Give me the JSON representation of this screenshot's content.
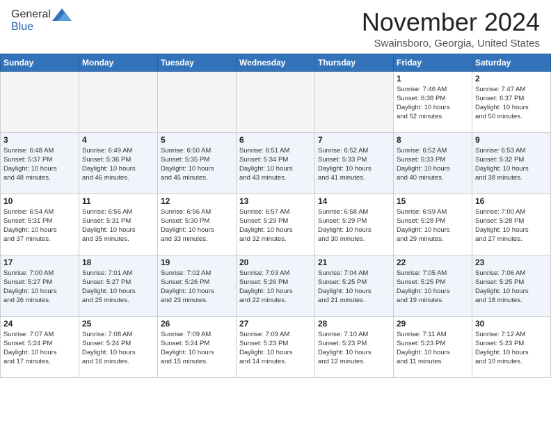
{
  "header": {
    "logo_general": "General",
    "logo_blue": "Blue",
    "month": "November 2024",
    "location": "Swainsboro, Georgia, United States"
  },
  "weekdays": [
    "Sunday",
    "Monday",
    "Tuesday",
    "Wednesday",
    "Thursday",
    "Friday",
    "Saturday"
  ],
  "weeks": [
    [
      {
        "day": "",
        "info": ""
      },
      {
        "day": "",
        "info": ""
      },
      {
        "day": "",
        "info": ""
      },
      {
        "day": "",
        "info": ""
      },
      {
        "day": "",
        "info": ""
      },
      {
        "day": "1",
        "info": "Sunrise: 7:46 AM\nSunset: 6:38 PM\nDaylight: 10 hours\nand 52 minutes."
      },
      {
        "day": "2",
        "info": "Sunrise: 7:47 AM\nSunset: 6:37 PM\nDaylight: 10 hours\nand 50 minutes."
      }
    ],
    [
      {
        "day": "3",
        "info": "Sunrise: 6:48 AM\nSunset: 5:37 PM\nDaylight: 10 hours\nand 48 minutes."
      },
      {
        "day": "4",
        "info": "Sunrise: 6:49 AM\nSunset: 5:36 PM\nDaylight: 10 hours\nand 46 minutes."
      },
      {
        "day": "5",
        "info": "Sunrise: 6:50 AM\nSunset: 5:35 PM\nDaylight: 10 hours\nand 45 minutes."
      },
      {
        "day": "6",
        "info": "Sunrise: 6:51 AM\nSunset: 5:34 PM\nDaylight: 10 hours\nand 43 minutes."
      },
      {
        "day": "7",
        "info": "Sunrise: 6:52 AM\nSunset: 5:33 PM\nDaylight: 10 hours\nand 41 minutes."
      },
      {
        "day": "8",
        "info": "Sunrise: 6:52 AM\nSunset: 5:33 PM\nDaylight: 10 hours\nand 40 minutes."
      },
      {
        "day": "9",
        "info": "Sunrise: 6:53 AM\nSunset: 5:32 PM\nDaylight: 10 hours\nand 38 minutes."
      }
    ],
    [
      {
        "day": "10",
        "info": "Sunrise: 6:54 AM\nSunset: 5:31 PM\nDaylight: 10 hours\nand 37 minutes."
      },
      {
        "day": "11",
        "info": "Sunrise: 6:55 AM\nSunset: 5:31 PM\nDaylight: 10 hours\nand 35 minutes."
      },
      {
        "day": "12",
        "info": "Sunrise: 6:56 AM\nSunset: 5:30 PM\nDaylight: 10 hours\nand 33 minutes."
      },
      {
        "day": "13",
        "info": "Sunrise: 6:57 AM\nSunset: 5:29 PM\nDaylight: 10 hours\nand 32 minutes."
      },
      {
        "day": "14",
        "info": "Sunrise: 6:58 AM\nSunset: 5:29 PM\nDaylight: 10 hours\nand 30 minutes."
      },
      {
        "day": "15",
        "info": "Sunrise: 6:59 AM\nSunset: 5:28 PM\nDaylight: 10 hours\nand 29 minutes."
      },
      {
        "day": "16",
        "info": "Sunrise: 7:00 AM\nSunset: 5:28 PM\nDaylight: 10 hours\nand 27 minutes."
      }
    ],
    [
      {
        "day": "17",
        "info": "Sunrise: 7:00 AM\nSunset: 5:27 PM\nDaylight: 10 hours\nand 26 minutes."
      },
      {
        "day": "18",
        "info": "Sunrise: 7:01 AM\nSunset: 5:27 PM\nDaylight: 10 hours\nand 25 minutes."
      },
      {
        "day": "19",
        "info": "Sunrise: 7:02 AM\nSunset: 5:26 PM\nDaylight: 10 hours\nand 23 minutes."
      },
      {
        "day": "20",
        "info": "Sunrise: 7:03 AM\nSunset: 5:26 PM\nDaylight: 10 hours\nand 22 minutes."
      },
      {
        "day": "21",
        "info": "Sunrise: 7:04 AM\nSunset: 5:25 PM\nDaylight: 10 hours\nand 21 minutes."
      },
      {
        "day": "22",
        "info": "Sunrise: 7:05 AM\nSunset: 5:25 PM\nDaylight: 10 hours\nand 19 minutes."
      },
      {
        "day": "23",
        "info": "Sunrise: 7:06 AM\nSunset: 5:25 PM\nDaylight: 10 hours\nand 18 minutes."
      }
    ],
    [
      {
        "day": "24",
        "info": "Sunrise: 7:07 AM\nSunset: 5:24 PM\nDaylight: 10 hours\nand 17 minutes."
      },
      {
        "day": "25",
        "info": "Sunrise: 7:08 AM\nSunset: 5:24 PM\nDaylight: 10 hours\nand 16 minutes."
      },
      {
        "day": "26",
        "info": "Sunrise: 7:09 AM\nSunset: 5:24 PM\nDaylight: 10 hours\nand 15 minutes."
      },
      {
        "day": "27",
        "info": "Sunrise: 7:09 AM\nSunset: 5:23 PM\nDaylight: 10 hours\nand 14 minutes."
      },
      {
        "day": "28",
        "info": "Sunrise: 7:10 AM\nSunset: 5:23 PM\nDaylight: 10 hours\nand 12 minutes."
      },
      {
        "day": "29",
        "info": "Sunrise: 7:11 AM\nSunset: 5:23 PM\nDaylight: 10 hours\nand 11 minutes."
      },
      {
        "day": "30",
        "info": "Sunrise: 7:12 AM\nSunset: 5:23 PM\nDaylight: 10 hours\nand 10 minutes."
      }
    ]
  ]
}
